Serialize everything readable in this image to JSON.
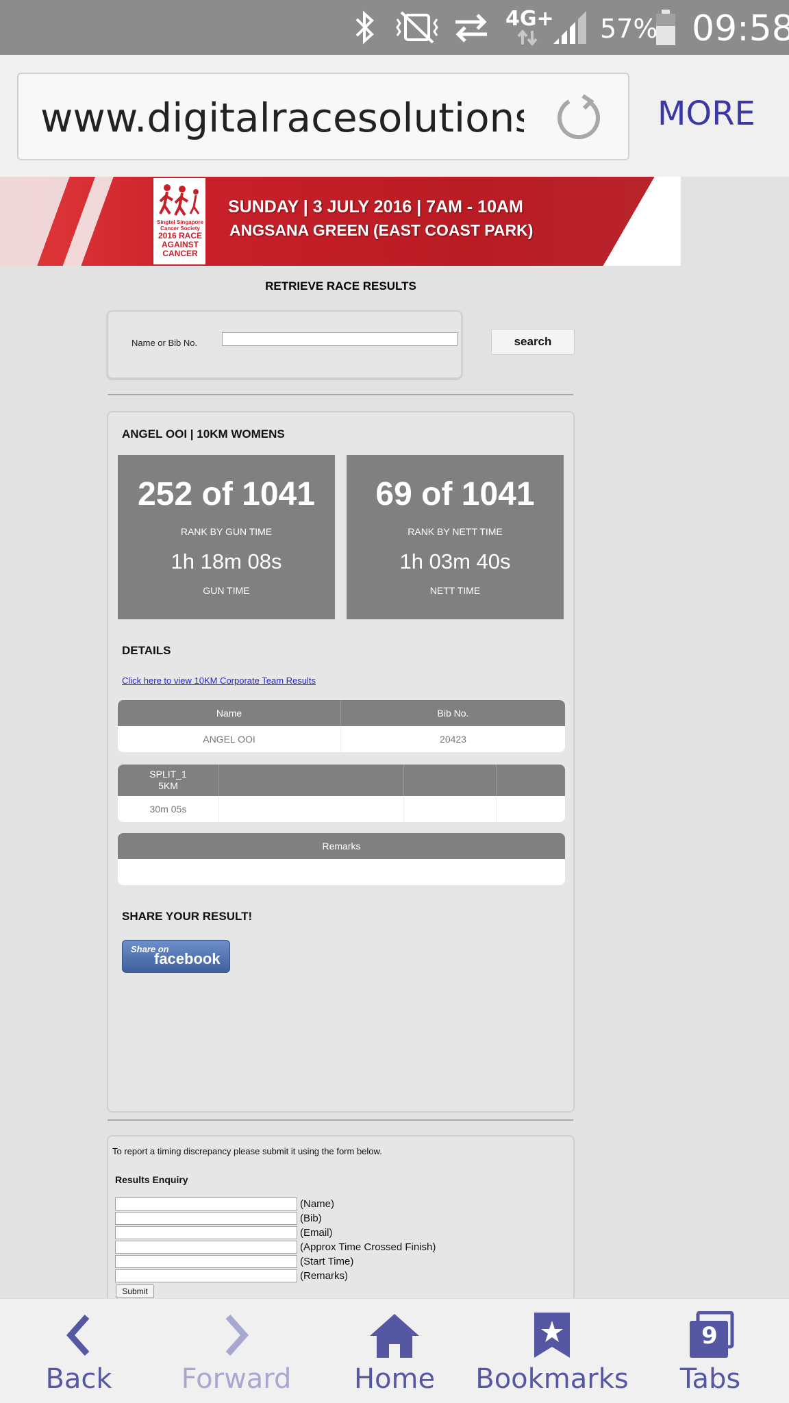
{
  "status_bar": {
    "network_type": "4G+",
    "battery": "57%",
    "time": "09:58",
    "icons": [
      "bluetooth-icon",
      "vibrate-mute-icon",
      "data-transfer-icon",
      "signal-icon",
      "battery-icon"
    ]
  },
  "browser": {
    "url": "www.digitalracesolutions.com",
    "more_label": "MORE"
  },
  "banner": {
    "logo_sponsor": "Singtel Singapore Cancer Society",
    "logo_text": "2016 RACE AGAINST CANCER",
    "line1": "SUNDAY | 3 JULY 2016 | 7AM - 10AM",
    "line2": "ANGSANA GREEN (EAST COAST PARK)"
  },
  "page": {
    "heading": "RETRIEVE RACE RESULTS",
    "search_label": "Name or Bib No.",
    "search_value": "",
    "search_button": "search"
  },
  "result": {
    "athlete_title": "ANGEL OOI | 10KM WOMENS",
    "gun": {
      "rank": "252 of 1041",
      "rank_label": "RANK BY GUN TIME",
      "time": "1h 18m 08s",
      "time_label": "GUN TIME"
    },
    "nett": {
      "rank": "69 of 1041",
      "rank_label": "RANK BY NETT TIME",
      "time": "1h 03m 40s",
      "time_label": "NETT TIME"
    },
    "details_heading": "DETAILS",
    "corporate_link": "Click here to view 10KM Corporate Team Results",
    "info_table": {
      "headers": [
        "Name",
        "Bib No."
      ],
      "row": [
        "ANGEL OOI",
        "20423"
      ]
    },
    "split_table": {
      "headers": [
        "SPLIT_1\n5KM",
        "",
        "",
        ""
      ],
      "row": [
        "30m 05s",
        "",
        "",
        ""
      ]
    },
    "remarks_table": {
      "header": "Remarks",
      "value": ""
    },
    "share_heading": "SHARE YOUR RESULT!",
    "facebook_small": "Share on",
    "facebook_big": "facebook"
  },
  "enquiry": {
    "note": "To report a timing discrepancy please submit it using the form below.",
    "heading": "Results Enquiry",
    "fields": [
      "(Name)",
      "(Bib)",
      "(Email)",
      "(Approx Time Crossed Finish)",
      "(Start Time)",
      "(Remarks)"
    ],
    "submit_label": "Submit"
  },
  "bottom_nav": {
    "back": "Back",
    "forward": "Forward",
    "home": "Home",
    "bookmarks": "Bookmarks",
    "tabs": "Tabs",
    "tab_count": "9"
  },
  "colors": {
    "accent": "#3b38a6",
    "nav": "#5657a2",
    "banner_red": "#c8202a",
    "rank_box": "#808080",
    "link": "#2424d6"
  }
}
